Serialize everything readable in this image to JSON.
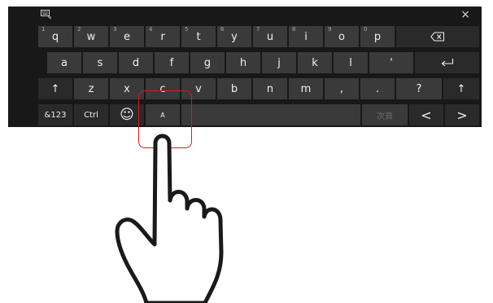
{
  "keyboard": {
    "close_label": "×",
    "rows": [
      [
        {
          "label": "q",
          "hint": "1"
        },
        {
          "label": "w",
          "hint": "2"
        },
        {
          "label": "e",
          "hint": "3"
        },
        {
          "label": "r",
          "hint": "4"
        },
        {
          "label": "t",
          "hint": "5"
        },
        {
          "label": "y",
          "hint": "6"
        },
        {
          "label": "u",
          "hint": "7"
        },
        {
          "label": "i",
          "hint": "8"
        },
        {
          "label": "o",
          "hint": "9"
        },
        {
          "label": "p",
          "hint": "0"
        },
        {
          "label": "",
          "icon": "backspace-icon"
        }
      ],
      [
        {
          "label": "a"
        },
        {
          "label": "s"
        },
        {
          "label": "d"
        },
        {
          "label": "f"
        },
        {
          "label": "g"
        },
        {
          "label": "h"
        },
        {
          "label": "j"
        },
        {
          "label": "k"
        },
        {
          "label": "l"
        },
        {
          "label": "'"
        },
        {
          "label": "",
          "icon": "enter-icon"
        }
      ],
      [
        {
          "label": "↑",
          "icon": "shift-icon"
        },
        {
          "label": "z"
        },
        {
          "label": "x"
        },
        {
          "label": "c"
        },
        {
          "label": "v"
        },
        {
          "label": "b"
        },
        {
          "label": "n"
        },
        {
          "label": "m"
        },
        {
          "label": ","
        },
        {
          "label": "."
        },
        {
          "label": "?"
        },
        {
          "label": "↑",
          "icon": "shift-icon"
        }
      ],
      [
        {
          "label": "&123"
        },
        {
          "label": "Ctrl"
        },
        {
          "label": "☺",
          "icon": "emoji-icon"
        },
        {
          "label": "A"
        },
        {
          "label": ""
        },
        {
          "label": "次頁"
        },
        {
          "label": "<",
          "icon": "left-arrow-icon"
        },
        {
          "label": ">",
          "icon": "right-arrow-icon"
        }
      ]
    ]
  },
  "annotation": {
    "highlight_color": "#e0191e",
    "icon": "pointing-hand-icon"
  }
}
